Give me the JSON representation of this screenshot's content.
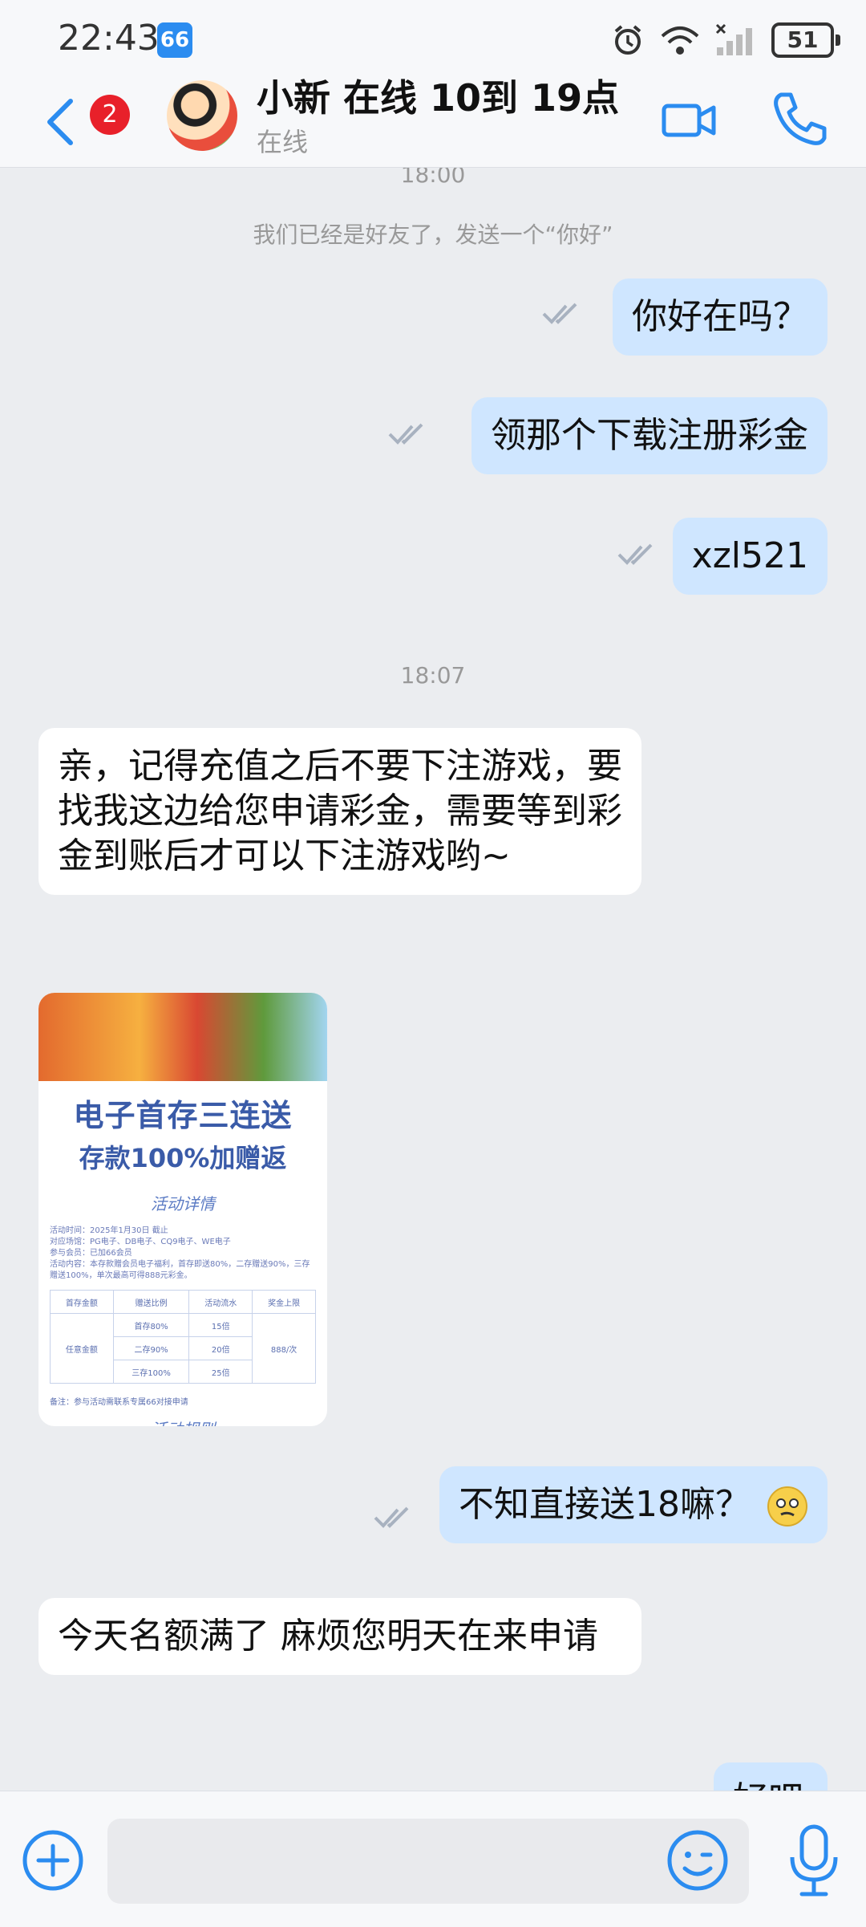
{
  "status_bar": {
    "time": "22:43",
    "app_badge": "66",
    "battery": "51"
  },
  "header": {
    "unread_count": "2",
    "contact_name": "小新 在线 10到 19点",
    "presence": "在线"
  },
  "messages": {
    "ts1": "18:00",
    "system": "我们已经是好友了，发送一个“你好”",
    "m1": "你好在吗？",
    "m2": "领那个下载注册彩金",
    "m3": "xzl521",
    "ts2": "18:07",
    "m4": "亲，记得充值之后不要下注游戏，要找我这边给您申请彩金，需要等到彩金到账后才可以下注游戏哟~",
    "m5": "不知直接送18嘛？",
    "m6": "今天名额满了 麻烦您明天在来申请",
    "m7_partial": "好吧"
  },
  "promo": {
    "title1": "电子首存三连送",
    "title2": "存款100%加赠返",
    "section1": "活动详情",
    "lines": [
      "活动时间：2025年1月30日 截止",
      "对应场馆：PG电子、DB电子、CQ9电子、WE电子",
      "参与会员：已加66会员",
      "活动内容：本存款赠会员电子福利，首存即送80%，二存赠送90%，三存赠送100%，单次最高可得888元彩金。"
    ],
    "table_header": [
      "首存金额",
      "赠送比例",
      "活动流水",
      "奖金上限"
    ],
    "row_label": "任意金额",
    "ratios": [
      "首存80%",
      "二存90%",
      "三存100%"
    ],
    "turnover": [
      "15倍",
      "20倍",
      "25倍"
    ],
    "cap": "888/次",
    "note": "备注：参与活动需联系专属66对接申请",
    "section2": "活动规则"
  },
  "input": {
    "placeholder": ""
  },
  "colors": {
    "accent": "#2b8cf0",
    "out_bubble": "#cfe6ff",
    "badge": "#e8202a",
    "background": "#ebedf0"
  }
}
